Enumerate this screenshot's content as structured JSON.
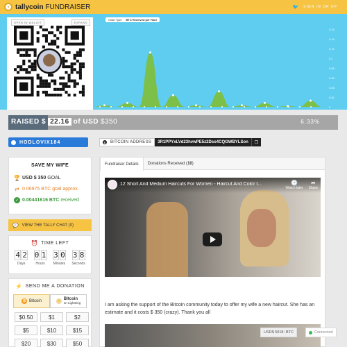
{
  "brand": {
    "name": "tallycoin",
    "suffix": "FUNDRAISER"
  },
  "topbar": {
    "signin_label": "SIGN IN OR UP",
    "twitter_icon": "twitter-icon"
  },
  "qr": {
    "open_label": "OPEN IN WALLET",
    "expand_label": "EXPAND"
  },
  "chart": {
    "legend_label": "Chart Type",
    "legend_series": "BTC Received per Hour"
  },
  "chart_data": {
    "type": "area",
    "series": [
      {
        "name": "BTC Received per Hour",
        "color": "#7cc04a"
      }
    ],
    "y_ticks": [
      "0.15",
      "0.14",
      "0.12",
      "0.1",
      "0.08",
      "0.06",
      "0.04",
      "0.02",
      "0"
    ],
    "peaks_relative": [
      0.02,
      0.05,
      0.7,
      0.15,
      0.02,
      0.2,
      0.02,
      0.05,
      0.01,
      0.08
    ],
    "title": "",
    "xlabel": "",
    "ylabel": ""
  },
  "progress": {
    "raised_label": "RAISED $",
    "raised_amount": "22.16",
    "of_label": "of USD",
    "goal_amount": "$350",
    "percent": "6.33%",
    "fraction": 0.0633
  },
  "user": {
    "name": "HODLOVIX184"
  },
  "goal": {
    "title": "SAVE MY WIFE",
    "usd_bold": "USD $ 350",
    "usd_suffix": "GOAL",
    "btc_approx": "0.06975 BTC goal approx.",
    "received_bold": "0.00441616 BTC",
    "received_suffix": "received"
  },
  "chat": {
    "label": "VIEW THE TALLY CHAT (0)"
  },
  "time": {
    "title": "TIME LEFT",
    "days": [
      "4",
      "2"
    ],
    "hours": [
      "0",
      "1"
    ],
    "minutes": [
      "3",
      "0"
    ],
    "seconds": [
      "3",
      "8"
    ],
    "days_label": "Days",
    "hours_label": "Hours",
    "minutes_label": "Minutes",
    "seconds_label": "Seconds"
  },
  "donate": {
    "title": "SEND ME A DONATION",
    "btc_tab": "Bitcoin",
    "ln_tab": "Bitcoin",
    "ln_sub": "on Lightning",
    "amounts": [
      "$0.50",
      "$1",
      "$2",
      "$5",
      "$10",
      "$15",
      "$20",
      "$30",
      "$50"
    ]
  },
  "address": {
    "label": "BITCOIN ADDRESS",
    "value": "3R1PPYxLVd23hvwPE5z2Dso4CQGWBYLSon"
  },
  "tabs": {
    "details": "Fundraiser Details",
    "donations": "Donations Received (",
    "donations_count": "10",
    "donations_close": ")"
  },
  "video": {
    "title": "12 Short And Medium Haircuts For Women - Haircut And Color t...",
    "watch_later": "Watch later",
    "share": "Share"
  },
  "description": "I am asking the support of the Bitcoin community today to offer my wife a new haircut. She has an estimate and it costs $ 350 (crazy). Thank you all",
  "rate": {
    "value": "USD$ 5018",
    "unit": "BTC"
  },
  "status": {
    "connected": "Connected"
  }
}
